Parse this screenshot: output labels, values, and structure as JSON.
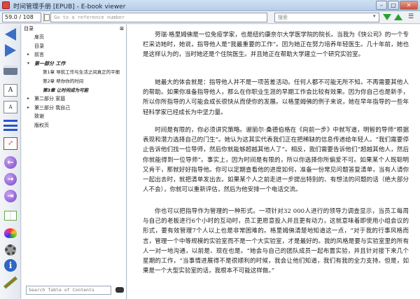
{
  "window": {
    "title": "时间管理手册 [EPUB] - E-book viewer",
    "minimize": "–",
    "maximize": "□",
    "close": "✕"
  },
  "toolbar": {
    "page_position": "59.0 / 108",
    "reference_placeholder": "Go to a reference number",
    "search_placeholder": "搜索",
    "search_dropdown": "▾",
    "menu_icon": "☰"
  },
  "sidebar_tools": {
    "icons": [
      "back-arrow-icon",
      "forward-arrow-icon",
      "print-icon",
      "font-larger-icon",
      "font-smaller-icon",
      "toc-icon",
      "fullscreen-icon",
      "previous-page-icon",
      "next-page-icon",
      "last-page-icon",
      "library-icon",
      "preferences-icon",
      "settings-gear-icon",
      "info-icon",
      "wand-icon"
    ],
    "font_larger": "A",
    "font_smaller": "A",
    "prev": "←",
    "next": "→",
    "last": "⇥",
    "info": "i",
    "fullscreen": "⤢"
  },
  "toc": {
    "header": "目录",
    "close": "⊠",
    "items": [
      {
        "label": "扉页",
        "twisty": ""
      },
      {
        "label": "目录",
        "twisty": ""
      },
      {
        "label": "前言",
        "twisty": "▸"
      },
      {
        "label": "第一部分 工作",
        "twisty": "▾"
      },
      {
        "label": "第1章 导航工作与生活之间真正的平衡",
        "twisty": ""
      },
      {
        "label": "第2章 帮你你的时间",
        "twisty": ""
      },
      {
        "label": "第3章 让时间成为可能",
        "twisty": ""
      },
      {
        "label": "第二部分 家庭",
        "twisty": "▸"
      },
      {
        "label": "第三部分 我自己",
        "twisty": "▸"
      },
      {
        "label": "致谢",
        "twisty": ""
      },
      {
        "label": "版权页",
        "twisty": ""
      }
    ],
    "search_placeholder": "Search Table of Contents"
  },
  "content": {
    "paragraphs": [
      "劳瑞·格里姆佛是一位免疫学家，也是纽约康奈尔大学医学院的院长。当我为《快公司》的一个专栏采访她时，她说，指导他人是“我最重要的工作”。因为她正在努力培养年轻医生。几十年前，她也是这样认为的，当时她还是个住院医生。并且她正在帮助大学建立一个研究实验室。",
      "她最大的体会就是：指导他人并不是一项苦差活动。任何人都不可能无所不知。不再需要其他人的帮助。如果你准备指导他人，那么在你职业生涯的早期工作会比较有效果。因为你自己也是新手，所以你所指导的人可能会成长很快从而使你的发展。以格里姆佛的例子来说，她在早年指导的一些年轻科学家已经成长为中坚力量。",
      "时间是有限的，你必须讲究策略。谢丽尔·桑德伯格在《向前一步》中就写道，明智的导师“根据表现和潜力选择自己的门生”。她认为这其实代表我们正在把稀缺的信息传递给年轻人。“我们需要停止告诉他们找一位导师，然后你就能够超越其他人了”。相反，我们需要告诉他们“超越其他人，然后你就能得到一位导师”。事实上，因为时间是有限的，所以你选择你所偏爱不可。如果某个人既聪明又肯干，那就好好指导他。你可以定期查看他的进度如何，准备一份常见问题答复清单，当有人请你一起出去时，就把清单发出去。如果某个人之前走进一步提出特别的、有想法的问题的话（绝大部分人不会），你就可以重新评估，然后为他安排一个电话交流。",
      "你也可以把指导作为管理的一种形式。一项针对32 000人进行的领导力调查显示，当员工每周与自己的老板进行6个小时的互动时，员工更愿意投入并且更有动力，这就意味着即使用小组会议的形式，要有效管理7个人以上也是非常困难的。格里姆佛清楚地知道这一点，“对于我的行事风格而言，管理一个中等规模的实验室而不是一个大实验室，才是最好的。我的风格是要与实验室里的所有人一对一地沟通，以前是、现在也是。“她会与自己的团队成员一起布置实验，并且针对接下来几个星期的工作，“当事情进展得不是很顺利的时候，我会让他们知道，我们有我的全力支持。但是，如果是一个大型实验室的话，我根本不可能这样做。”"
    ]
  }
}
